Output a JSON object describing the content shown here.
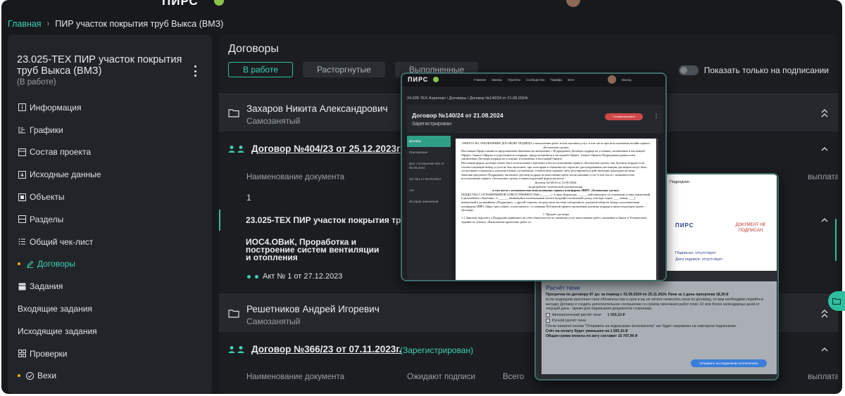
{
  "breadcrumb": {
    "home": "Главная",
    "current": "ПИР участок покрытия труб Выкса (ВМЗ)"
  },
  "sidebar": {
    "project_title": "23.025-ТЕХ ПИР участок покрытия труб Выкса (ВМЗ)",
    "project_status": "(В работе)",
    "items": [
      {
        "label": "Информация",
        "icon": "info-icon"
      },
      {
        "label": "Графики",
        "icon": "chart-icon"
      },
      {
        "label": "Состав проекта",
        "icon": "composition-icon"
      },
      {
        "label": "Исходные данные",
        "icon": "download-icon"
      },
      {
        "label": "Объекты",
        "icon": "objects-icon"
      },
      {
        "label": "Разделы",
        "icon": "sections-icon"
      },
      {
        "label": "Общий чек-лист",
        "icon": "checklist-icon"
      },
      {
        "label": "Договоры",
        "icon": "pen-icon"
      },
      {
        "label": "Задания",
        "icon": "tasks-icon"
      },
      {
        "label": "Входящие задания",
        "icon": ""
      },
      {
        "label": "Исходящие задания",
        "icon": ""
      },
      {
        "label": "Проверки",
        "icon": "grid-icon"
      },
      {
        "label": "Вехи",
        "icon": "check-circle-icon"
      }
    ]
  },
  "main": {
    "title": "Договоры",
    "tabs": [
      "В работе",
      "Расторгнутые",
      "Выполненные"
    ],
    "toggle_label": "Показать только на подписании",
    "contractor1": {
      "name": "Захаров Никита Александрович",
      "type": "Самозанятый"
    },
    "contract1": {
      "link": "Договор №404/23 от 25.12.2023г"
    },
    "table1": {
      "col_name": "Наименование документа",
      "col_paid": "выплата",
      "row_num": "1"
    },
    "section": "23.025-ТЕХ ПИР участок покрытия труб Вы",
    "subsection": "ИОС4.ОВиК, Проработка и построение систем вентиляции и отопления",
    "act": "Акт № 1 от 27.12.2023",
    "contractor2": {
      "name": "Решетников Андрей Игоревич",
      "type": "Самозанятый"
    },
    "contract2": {
      "link": "Договор №366/23 от 07.11.2023г.",
      "status": "(Зарегистрирован)"
    },
    "table2": {
      "col_name": "Наименование документа",
      "col_wait": "Ожидают подписи",
      "col_total": "Всего",
      "col_paid": "выплата"
    }
  },
  "shot1": {
    "logo": "ПИРС",
    "menu": [
      "Главная",
      "Заказы",
      "Проекты",
      "Сообщество",
      "Тарифы",
      "Блог"
    ],
    "exit": "Выход",
    "breadcrumb": "24.005-ТЕХ Аэропорт  /  Договоры  /  Договор №140/24 от 21.08.2024г.",
    "title": "Договор №140/24 от 21.08.2024",
    "status": "Зарегистрирован",
    "button": "Сконвертировать",
    "side": [
      "Договор",
      "Приложение",
      "Доп. соглашение №1 от 05.09.2024",
      "Акт №1 от 06.09.2024",
      "Акт",
      "История изменений"
    ],
    "doc_heading": "ОФЕРТА НА ЗАКЛЮЧЕНИЕ ДОГОВОРА ПОДРЯДА о выполнении работ и/или оказании услуг, в том числе при использовании онлайн-сервиса «Безопасная сделка»",
    "doc_p1": "Настоящая Оферта является предложением Заказчика на заключение с Подрядчиком Договора подряда на условиях, изложенных в настоящей Оферте. Акцепт Оферты осуществляется в порядке, предусмотренном в настоящей Оферте. Акцепт Оферты Подрядчиком равносилен заключению Договора подряда на условиях, изложенных в настоящей Оферте.",
    "doc_p2": "Настоящая форма договора может быть использована сторонами и без использования сервиса «Безопасная сделка» как Договор подряда если соответствующий выбор услуги не был выполнен, при этом права и обязанности сторон не урегулированные настоящим договором могут быть согласованы сторонами в дополнительных соглашениях, техническом задании, либо регулироваться действующим законодательством.",
    "doc_p3": "Заказчик предлагает Подрядчику заключить Договор подряда на выполнение работ и/или оказание услуг в том числе с возможностью использования сервиса «Безопасная сделка» в нижеследующей форме расчетов.",
    "doc_c1": "Договор №140/24 от 21.08.2024г.",
    "doc_c2": "на разработку технической документации,",
    "doc_c3": "в том числе с возможностью использования сервиса платформы ПИРС «Безопасная сделка»",
    "doc_p4": "ОБЩЕСТВО С ОГРАНИЧЕННОЙ ОТВЕТСТВЕННОСТЬЮ «______», в лице Директора ______, действующего на основании устава, именуемый в дальнейшем «Заказчик», и ______, являющийся плательщиком налога на профессиональный доход, (паспорт серия ____ номер ____) именуемый в дальнейшем «Подрядчик», с другой стороны, посредством системы электронного документооборота между пользователями платформы ПИРС (https://pirs.online), согласовались с условиями Публичной оферты заключения договора подряда в нижеследующем (далее – Договор):",
    "doc_c4": "1. Предмет договора",
    "doc_p5": "1.1 Заказчик поручает, а Подрядчик принимает на себя обязательство по оказанию услуг выполнению работ, указанные в Заказе и Техническом задании по объекту «Выполнение проектных работ по"
  },
  "shot2": {
    "label": "Подрядчик:",
    "logo": "ПИРС",
    "not_signed": "ДОКУМЕНТ НЕ ПОДПИСАН",
    "signed_line1": "Подписал: отсутствует",
    "signed_line2": "Дата подписи: отсутствует",
    "penalty_title": "Расчёт пени",
    "penalty_bold": "Просрочка по договору 87 дн. за период с 31.08.2024 по 25.11.2024. Пеня за 1 день просрочки 18,30 ₽",
    "penalty_text": "Если подрядчик выполнил свои обязательства в срок и вы не хотите начислять пени по договору, то вам необходимо перейти в вкладку Договор и создать дополнительное соглашение со сроком окончания работ плюс 10 или более календарных дней от текущей даты - время для подписания документов сторонами.",
    "auto_label": "Автоматический расчёт пени",
    "auto_value": "1 592,10 ₽",
    "manual_label": "Ручной расчёт пени",
    "note": "После нажатия кнопки \"Отправить на подписание исполнителю\" акт будет направлен на повторное подписание.",
    "reduced": "Счёт на оплату будет уменьшен на 1 592,10 ₽",
    "total": "Общая сумма оплаты по акту составит 16 707,90 ₽",
    "button": "Отправить на подписание исполнителю"
  },
  "colors": {
    "accent": "#3fd0b3",
    "bg": "#17191c",
    "panel": "#212428",
    "bullet": "#f0b000"
  }
}
